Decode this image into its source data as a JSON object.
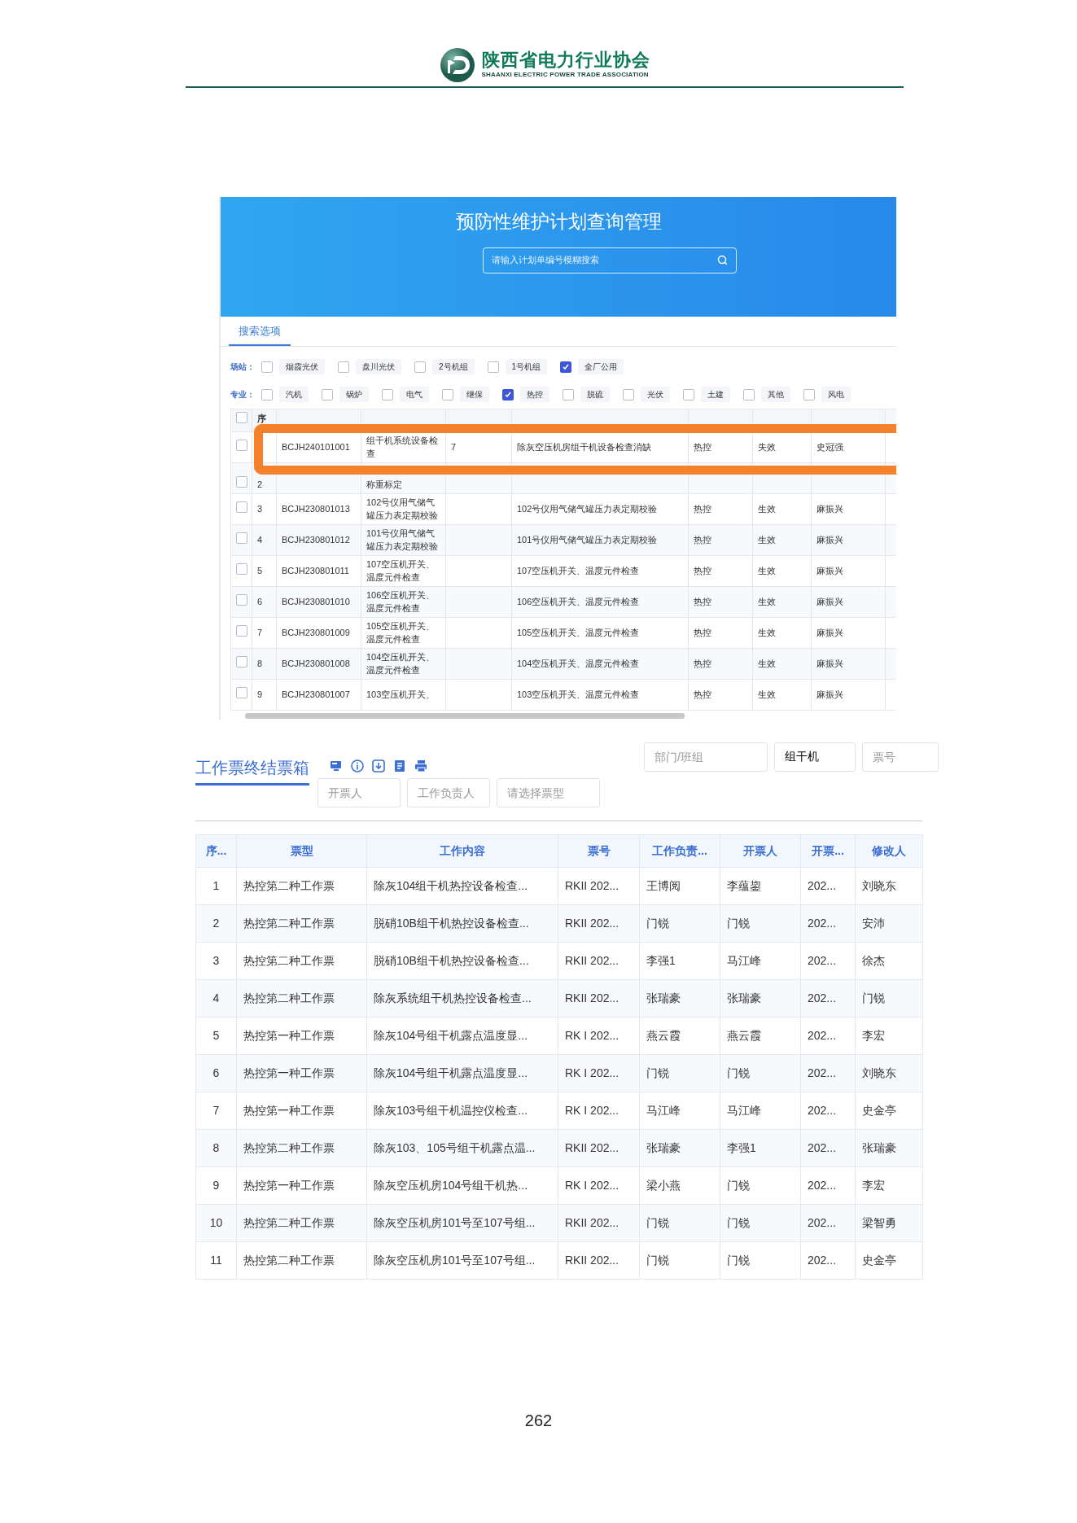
{
  "header": {
    "org_name": "陕西省电力行业协会",
    "org_name_en": "SHAANXI ELECTRIC POWER TRADE ASSOCIATION"
  },
  "plan_screen": {
    "title": "预防性维护计划查询管理",
    "search": {
      "placeholder": "请输入计划单编号模糊搜索"
    },
    "tab": {
      "label": "搜索选项",
      "selected": true
    },
    "filters": [
      {
        "label": "场站：",
        "options": [
          {
            "label": "烟霞光伏",
            "checked": false
          },
          {
            "label": "盘川光伏",
            "checked": false
          },
          {
            "label": "2号机组",
            "checked": false
          },
          {
            "label": "1号机组",
            "checked": false
          },
          {
            "label": "全厂公用",
            "checked": true
          }
        ]
      },
      {
        "label": "专业：",
        "options": [
          {
            "label": "汽机",
            "checked": false
          },
          {
            "label": "锅炉",
            "checked": false
          },
          {
            "label": "电气",
            "checked": false
          },
          {
            "label": "继保",
            "checked": false
          },
          {
            "label": "热控",
            "checked": true
          },
          {
            "label": "脱硫",
            "checked": false
          },
          {
            "label": "光伏",
            "checked": false
          },
          {
            "label": "土建",
            "checked": false
          },
          {
            "label": "其他",
            "checked": false
          },
          {
            "label": "风电",
            "checked": false
          }
        ]
      }
    ],
    "header": {
      "select_all": false,
      "seq": "序"
    },
    "rows": [
      {
        "checked": false,
        "code": "BCJH240101001",
        "name": "组干机系统设备检查",
        "count": "7",
        "content": "除灰空压机房组干机设备检查消缺",
        "specialty": "热控",
        "status": "失效",
        "creator": "史冠强",
        "highlighted": true
      },
      {
        "checked": false,
        "seq": "2",
        "name": "称重标定",
        "highlighted": false
      },
      {
        "checked": false,
        "seq": "3",
        "code": "BCJH230801013",
        "name": "102号仪用气储气罐压力表定期校验",
        "content": "102号仪用气储气罐压力表定期校验",
        "specialty": "热控",
        "status": "生效",
        "creator": "麻振兴",
        "highlighted": false
      },
      {
        "checked": false,
        "seq": "4",
        "code": "BCJH230801012",
        "name": "101号仪用气储气罐压力表定期校验",
        "content": "101号仪用气储气罐压力表定期校验",
        "specialty": "热控",
        "status": "生效",
        "creator": "麻振兴",
        "highlighted": false
      },
      {
        "checked": false,
        "seq": "5",
        "code": "BCJH230801011",
        "name": "107空压机开关、温度元件检查",
        "content": "107空压机开关、温度元件检查",
        "specialty": "热控",
        "status": "生效",
        "creator": "麻振兴",
        "highlighted": false
      },
      {
        "checked": false,
        "seq": "6",
        "code": "BCJH230801010",
        "name": "106空压机开关、温度元件检查",
        "content": "106空压机开关、温度元件检查",
        "specialty": "热控",
        "status": "生效",
        "creator": "麻振兴",
        "highlighted": false
      },
      {
        "checked": false,
        "seq": "7",
        "code": "BCJH230801009",
        "name": "105空压机开关、温度元件检查",
        "content": "105空压机开关、温度元件检查",
        "specialty": "热控",
        "status": "生效",
        "creator": "麻振兴",
        "highlighted": false
      },
      {
        "checked": false,
        "seq": "8",
        "code": "BCJH230801008",
        "name": "104空压机开关、温度元件检查",
        "content": "104空压机开关、温度元件检查",
        "specialty": "热控",
        "status": "生效",
        "creator": "麻振兴",
        "highlighted": false
      },
      {
        "checked": false,
        "seq": "9",
        "code": "BCJH230801007",
        "name": "103空压机开关、",
        "content": "103空压机开关、温度元件检查",
        "specialty": "热控",
        "status": "生效",
        "creator": "麻振兴",
        "highlighted": false
      }
    ]
  },
  "ticket_screen": {
    "title": "工作票终结票箱",
    "fields": [
      {
        "placeholder": "部门/班组"
      },
      {
        "value": "组干机"
      },
      {
        "placeholder": "票号"
      },
      {
        "placeholder": "开票人"
      },
      {
        "placeholder": "工作负责人"
      },
      {
        "placeholder": "请选择票型"
      }
    ],
    "columns": [
      "序...",
      "票型",
      "工作内容",
      "票号",
      "工作负责...",
      "开票人",
      "开票...",
      "修改人"
    ],
    "rows": [
      [
        "1",
        "热控第二种工作票",
        "除灰104组干机热控设备检查...",
        "RKII 202...",
        "王博阅",
        "李蕴鋆",
        "202...",
        "刘晓东"
      ],
      [
        "2",
        "热控第二种工作票",
        "脱硝10B组干机热控设备检查...",
        "RKII 202...",
        "门锐",
        "门锐",
        "202...",
        "安沛"
      ],
      [
        "3",
        "热控第二种工作票",
        "脱硝10B组干机热控设备检查...",
        "RKII 202...",
        "李强1",
        "马江峰",
        "202...",
        "徐杰"
      ],
      [
        "4",
        "热控第二种工作票",
        "除灰系统组干机热控设备检查...",
        "RKII 202...",
        "张瑞豪",
        "张瑞豪",
        "202...",
        "门锐"
      ],
      [
        "5",
        "热控第一种工作票",
        "除灰104号组干机露点温度显...",
        "RK I 202...",
        "燕云霞",
        "燕云霞",
        "202...",
        "李宏"
      ],
      [
        "6",
        "热控第一种工作票",
        "除灰104号组干机露点温度显...",
        "RK I 202...",
        "门锐",
        "门锐",
        "202...",
        "刘晓东"
      ],
      [
        "7",
        "热控第一种工作票",
        "除灰103号组干机温控仪检查...",
        "RK I 202...",
        "马江峰",
        "马江峰",
        "202...",
        "史金亭"
      ],
      [
        "8",
        "热控第二种工作票",
        "除灰103、105号组干机露点温...",
        "RKII 202...",
        "张瑞豪",
        "李强1",
        "202...",
        "张瑞豪"
      ],
      [
        "9",
        "热控第一种工作票",
        "除灰空压机房104号组干机热...",
        "RK I 202...",
        "梁小燕",
        "门锐",
        "202...",
        "李宏"
      ],
      [
        "10",
        "热控第二种工作票",
        "除灰空压机房101号至107号组...",
        "RKII 202...",
        "门锐",
        "门锐",
        "202...",
        "梁智勇"
      ],
      [
        "11",
        "热控第二种工作票",
        "除灰空压机房101号至107号组...",
        "RKII 202...",
        "门锐",
        "门锐",
        "202...",
        "史金亭"
      ]
    ]
  },
  "page_number": "262"
}
